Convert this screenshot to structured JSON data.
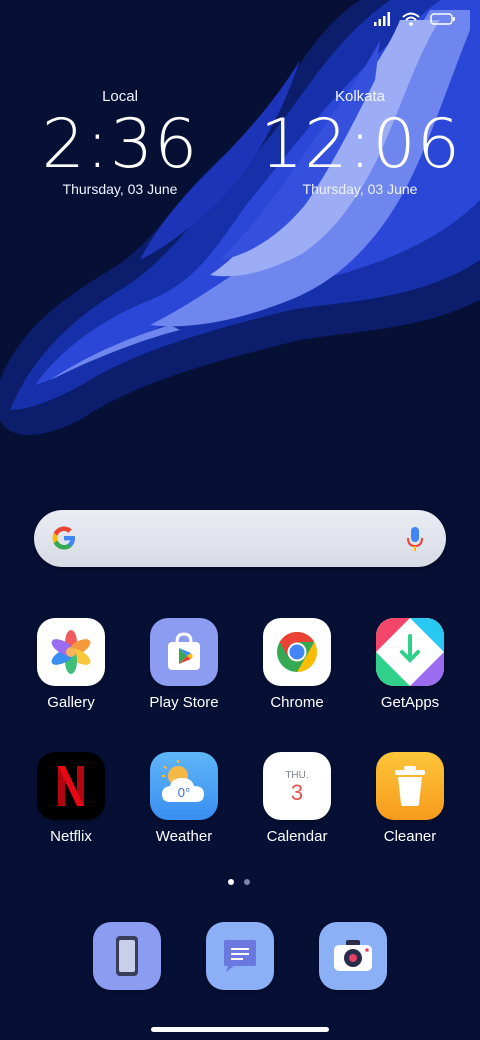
{
  "clocks": {
    "local": {
      "city": "Local",
      "time": "2:36",
      "date": "Thursday, 03 June"
    },
    "remote": {
      "city": "Kolkata",
      "time": "12:06",
      "date": "Thursday, 03 June"
    }
  },
  "status_bar": {
    "icons": [
      "signal-icon",
      "wifi-icon",
      "battery-icon"
    ]
  },
  "search": {
    "icons": [
      "google-g-icon",
      "microphone-icon"
    ]
  },
  "apps": [
    {
      "label": "Gallery",
      "icon": "gallery-icon"
    },
    {
      "label": "Play Store",
      "icon": "play-store-icon"
    },
    {
      "label": "Chrome",
      "icon": "chrome-icon"
    },
    {
      "label": "GetApps",
      "icon": "getapps-icon"
    },
    {
      "label": "Netflix",
      "icon": "netflix-icon"
    },
    {
      "label": "Weather",
      "icon": "weather-icon",
      "temperature": "0°"
    },
    {
      "label": "Calendar",
      "icon": "calendar-icon",
      "day": "THU.",
      "date": "3"
    },
    {
      "label": "Cleaner",
      "icon": "cleaner-icon"
    }
  ],
  "page_indicator": {
    "current": 1,
    "total": 2
  },
  "dock": [
    {
      "icon": "phone-icon"
    },
    {
      "icon": "messages-icon"
    },
    {
      "icon": "camera-icon"
    }
  ],
  "colors": {
    "background": "#061035",
    "wave_light": "#8a9cf2",
    "wave_mid": "#2c46d6",
    "dock_icon_bg": "#8c9cf0"
  }
}
